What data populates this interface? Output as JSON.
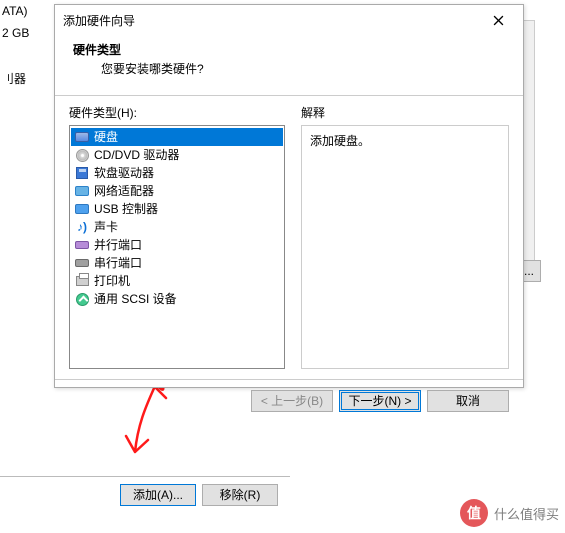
{
  "background": {
    "left_lines": [
      "ATA)",
      "2 GB",
      "刂器"
    ],
    "v_button": "(V)...",
    "add_button": "添加(A)...",
    "remove_button": "移除(R)"
  },
  "dialog": {
    "title": "添加硬件向导",
    "header_title": "硬件类型",
    "header_sub": "您要安装哪类硬件?",
    "left_label": "硬件类型(H):",
    "right_label": "解释",
    "desc_text": "添加硬盘。",
    "items": [
      {
        "id": "hdd",
        "label": "硬盘",
        "selected": true
      },
      {
        "id": "cd",
        "label": "CD/DVD 驱动器"
      },
      {
        "id": "floppy",
        "label": "软盘驱动器"
      },
      {
        "id": "nic",
        "label": "网络适配器"
      },
      {
        "id": "usb",
        "label": "USB 控制器"
      },
      {
        "id": "sound",
        "label": "声卡"
      },
      {
        "id": "parallel",
        "label": "并行端口"
      },
      {
        "id": "serial",
        "label": "串行端口"
      },
      {
        "id": "printer",
        "label": "打印机"
      },
      {
        "id": "scsi",
        "label": "通用 SCSI 设备"
      }
    ],
    "back_btn": "< 上一步(B)",
    "next_btn": "下一步(N) >",
    "cancel_btn": "取消"
  },
  "watermark": {
    "logo_text": "值",
    "brand": "什么值得买"
  }
}
